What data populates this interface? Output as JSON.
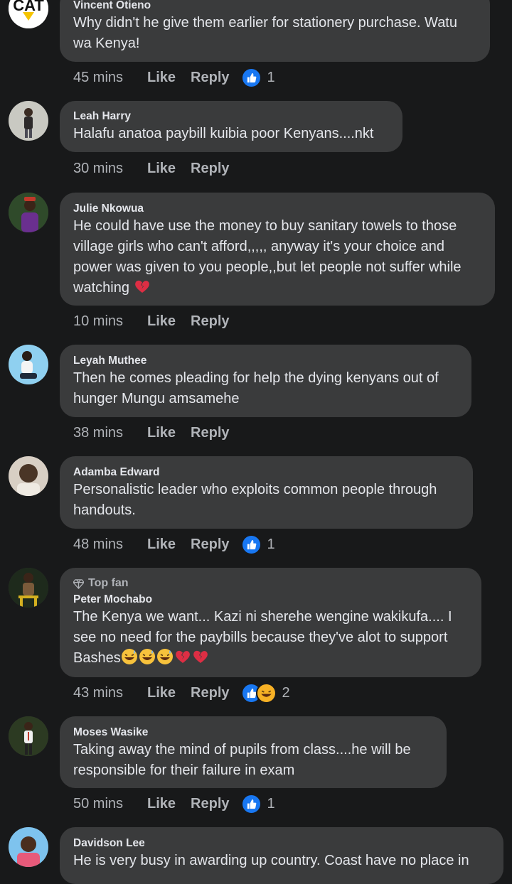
{
  "comments": [
    {
      "name": "Vincent Otieno",
      "text": "Why didn't he give them earlier for stationery purchase. Watu wa Kenya!",
      "time": "45 mins",
      "like_label": "Like",
      "reply_label": "Reply",
      "reaction_count": "1",
      "avatar_text": "CAT"
    },
    {
      "name": "Leah Harry",
      "text": "Halafu anatoa paybill kuibia poor Kenyans....nkt",
      "time": "30 mins",
      "like_label": "Like",
      "reply_label": "Reply"
    },
    {
      "name": "Julie Nkowua",
      "text": "He could have use the money to buy sanitary towels to those village girls who can't afford,,,,, anyway it's your choice and power was given to you people,,but let people not suffer while watching",
      "time": "10 mins",
      "like_label": "Like",
      "reply_label": "Reply"
    },
    {
      "name": "Leyah Muthee",
      "text": "Then he comes pleading for help the dying kenyans out of hunger Mungu amsamehe",
      "time": "38 mins",
      "like_label": "Like",
      "reply_label": "Reply"
    },
    {
      "name": "Adamba Edward",
      "text": "Personalistic leader who exploits common people through handouts.",
      "time": "48 mins",
      "like_label": "Like",
      "reply_label": "Reply",
      "reaction_count": "1"
    },
    {
      "badge": "Top fan",
      "name": "Peter Mochabo",
      "text": "The Kenya we want... Kazi ni sherehe wengine wakikufa.... I see no need for the paybills because they've alot to support Bashes",
      "time": "43 mins",
      "like_label": "Like",
      "reply_label": "Reply",
      "reaction_count": "2"
    },
    {
      "name": "Moses Wasike",
      "text": "Taking away the mind of pupils from class....he will be responsible for their failure in exam",
      "time": "50 mins",
      "like_label": "Like",
      "reply_label": "Reply",
      "reaction_count": "1"
    },
    {
      "name": "Davidson Lee",
      "text": "He is very busy in awarding up country.  Coast have no place in"
    }
  ],
  "colors": {
    "background": "#18191a",
    "bubble": "#3a3b3c",
    "like_blue": "#1877f2",
    "haha_yellow": "#f7b125",
    "secondary_text": "#b0b3b8"
  },
  "icons": [
    "like-reaction-icon",
    "haha-reaction-icon",
    "broken-heart-emoji",
    "grinning-sweat-emoji",
    "top-fan-diamond-icon"
  ]
}
